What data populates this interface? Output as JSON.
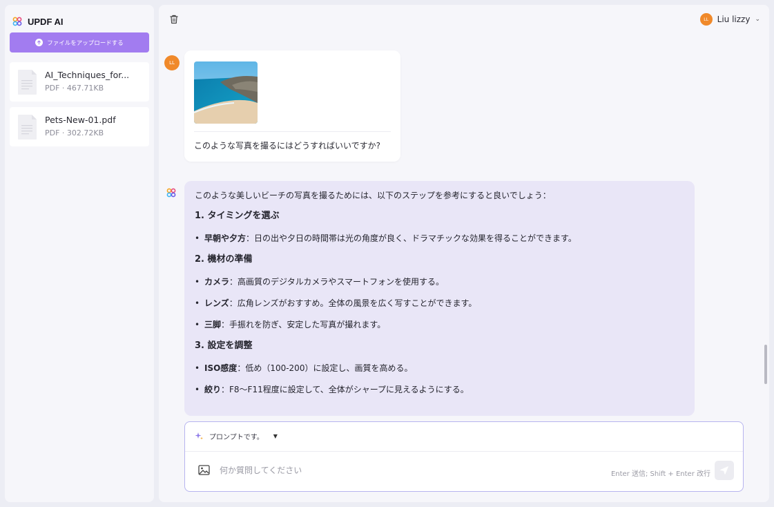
{
  "app": {
    "title": "UPDF AI"
  },
  "sidebar": {
    "upload_label": "ファイルをアップロードする",
    "files": [
      {
        "name": "AI_Techniques_for...",
        "meta": "PDF · 467.71KB"
      },
      {
        "name": "Pets-New-01.pdf",
        "meta": "PDF · 302.72KB"
      }
    ]
  },
  "header": {
    "user_name": "Liu lizzy",
    "avatar_initials": "LL"
  },
  "chat": {
    "user_avatar": "LL",
    "user_question": "このような写真を撮るにはどうすればいいですか?",
    "ai_intro": "このような美しいビーチの写真を撮るためには、以下のステップを参考にすると良いでしょう：",
    "sections": [
      {
        "heading": "1. タイミングを選ぶ",
        "items": [
          {
            "term": "早朝や夕方",
            "text": "：日の出や夕日の時間帯は光の角度が良く、ドラマチックな効果を得ることができます。"
          }
        ]
      },
      {
        "heading": "2. 機材の準備",
        "items": [
          {
            "term": "カメラ",
            "text": "：高画質のデジタルカメラやスマートフォンを使用する。"
          },
          {
            "term": "レンズ",
            "text": "：広角レンズがおすすめ。全体の風景を広く写すことができます。"
          },
          {
            "term": "三脚",
            "text": "：手振れを防ぎ、安定した写真が撮れます。"
          }
        ]
      },
      {
        "heading": "3. 設定を調整",
        "items": [
          {
            "term": "ISO感度",
            "text": "：低め（100-200）に設定し、画質を高める。"
          },
          {
            "term": "絞り",
            "text": "：F8〜F11程度に設定して、全体がシャープに見えるようにする。"
          }
        ]
      }
    ]
  },
  "composer": {
    "prompt_label": "プロンプトです。",
    "placeholder": "何か質問してください",
    "hint": "Enter 送信; Shift + Enter 改行"
  },
  "colors": {
    "accent": "#a27cf0",
    "avatar": "#f0892a",
    "ai_bubble": "#e9e6f7"
  }
}
